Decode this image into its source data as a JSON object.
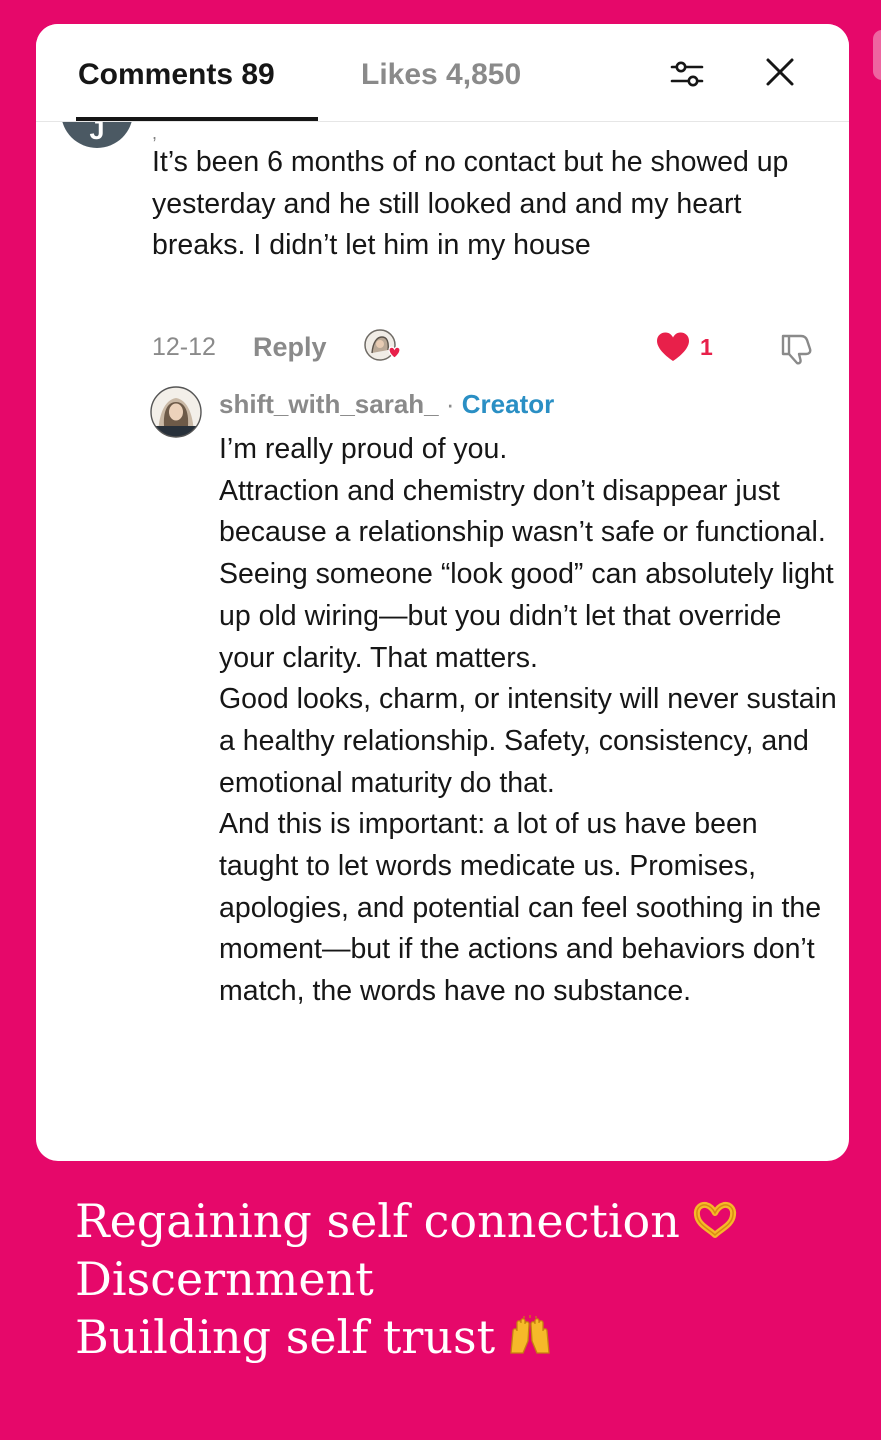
{
  "header": {
    "comments_tab": "Comments 89",
    "likes_tab": "Likes 4,850",
    "filter_icon": "sliders-icon",
    "close_icon": "close-icon"
  },
  "comment": {
    "avatar_initial": "J",
    "username_fragment": ",",
    "text": "It’s been 6 months of no contact but he showed up yesterday and he still looked and and my heart breaks. I didn’t let him in my house",
    "date": "12-12",
    "reply_label": "Reply",
    "like_count": "1",
    "like_color": "#e8204a"
  },
  "reply": {
    "username": "shift_with_sarah_",
    "separator": "·",
    "badge": "Creator",
    "badge_color": "#2a8fc4",
    "paragraphs": [
      "I’m really proud of you.",
      "Attraction and chemistry don’t disappear just because a relationship wasn’t safe or functional. Seeing someone “look good” can absolutely light up old wiring—but you didn’t let that override your clarity. That matters.",
      "Good looks, charm, or intensity will never sustain a healthy relationship. Safety, consistency, and emotional maturity do that.",
      "And this is important: a lot of us have been taught to let words medicate us. Promises, apologies, and potential can feel soothing in the moment—but if the actions and behaviors don’t match, the words have no substance."
    ]
  },
  "caption": {
    "lines": [
      "Regaining self connection",
      "Discernment",
      "Building self trust"
    ],
    "emoji_1": "heart-hands-icon",
    "emoji_3": "raised-hands-icon"
  },
  "colors": {
    "background": "#e6086a",
    "card": "#ffffff"
  }
}
